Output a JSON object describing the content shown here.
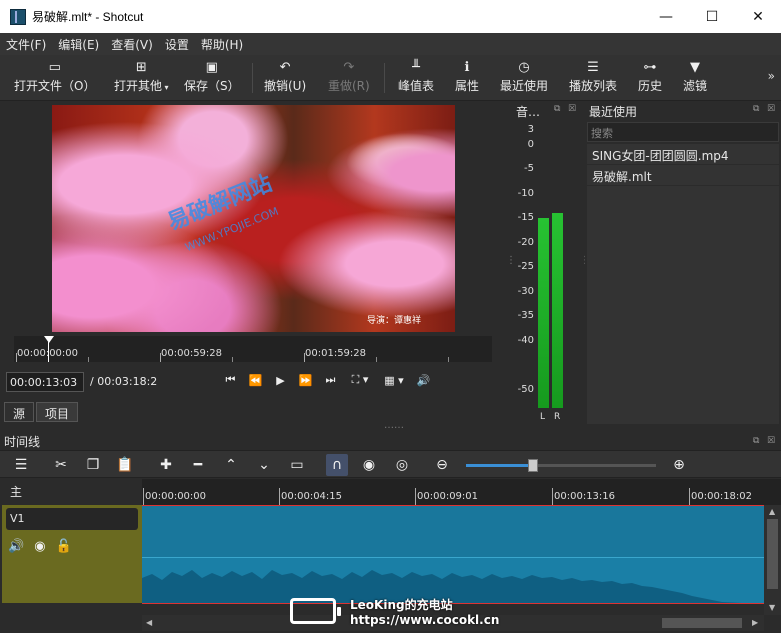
{
  "window": {
    "title": "易破解.mlt* - Shotcut",
    "minimize": "—",
    "maximize": "☐",
    "close": "✕"
  },
  "menu": [
    "文件(F)",
    "编辑(E)",
    "查看(V)",
    "设置",
    "帮助(H)"
  ],
  "toolbar": {
    "open_file": "打开文件（O）",
    "open_other": "打开其他",
    "save": "保存（S）",
    "undo": "撤销(U)",
    "redo": "重做(R)",
    "peak_meter": "峰值表",
    "properties": "属性",
    "recent": "最近使用",
    "playlist": "播放列表",
    "history": "历史",
    "filters": "滤镜",
    "more": "»"
  },
  "player": {
    "video_watermark": "易破解网站",
    "video_watermark_url": "WWW.YPOJIE.COM",
    "video_caption": "导演：谭惠祥",
    "ruler_labels": [
      "00:00:00:00",
      "00:00:59:28",
      "00:01:59:28"
    ],
    "current_time": "00:00:13:03",
    "duration": "/ 00:03:18:2",
    "tabs": [
      "源",
      "项目"
    ]
  },
  "meter": {
    "title": "音…",
    "scale": [
      "3",
      "0",
      "-5",
      "-10",
      "-15",
      "-20",
      "-25",
      "-30",
      "-35",
      "-40",
      "-50"
    ],
    "left_level_db": -15,
    "right_level_db": -14,
    "left_label": "L",
    "right_label": "R"
  },
  "recent": {
    "title": "最近使用",
    "search_placeholder": "搜索",
    "items": [
      "SING女团-团团圆圆.mp4",
      "易破解.mlt"
    ]
  },
  "timeline": {
    "title": "时间线",
    "master_label": "主",
    "track_name": "V1",
    "ruler_labels": [
      "00:00:00:00",
      "00:00:04:15",
      "00:00:09:01",
      "00:00:13:16",
      "00:00:18:02"
    ],
    "zoom_level": 0.35
  },
  "watermark": {
    "line1": "LeoKing的充电站",
    "line2": "https://www.cocokl.cn"
  },
  "colors": {
    "accent": "#3a8fd6",
    "clip": "#1a7fa6",
    "track_header": "#6a6a20",
    "meter_green": "#27c232"
  }
}
